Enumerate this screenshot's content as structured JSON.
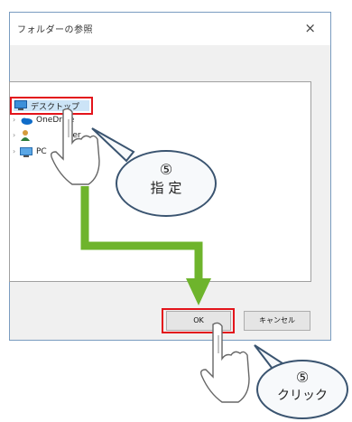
{
  "dialog": {
    "title": "フォルダーの参照",
    "close_glyph": "×"
  },
  "tree": {
    "items": [
      {
        "label": "デスクトップ"
      },
      {
        "label": "OneDrive"
      },
      {
        "label": "user"
      },
      {
        "label": "PC"
      }
    ]
  },
  "buttons": {
    "ok": "OK",
    "cancel": "キャンセル"
  },
  "annotations": [
    {
      "number": "⑤",
      "label": "指 定"
    },
    {
      "number": "⑤",
      "label": "クリック"
    }
  ],
  "colors": {
    "highlight": "#e3141b",
    "arrow": "#6eb42c",
    "selection": "#cce4f7"
  }
}
